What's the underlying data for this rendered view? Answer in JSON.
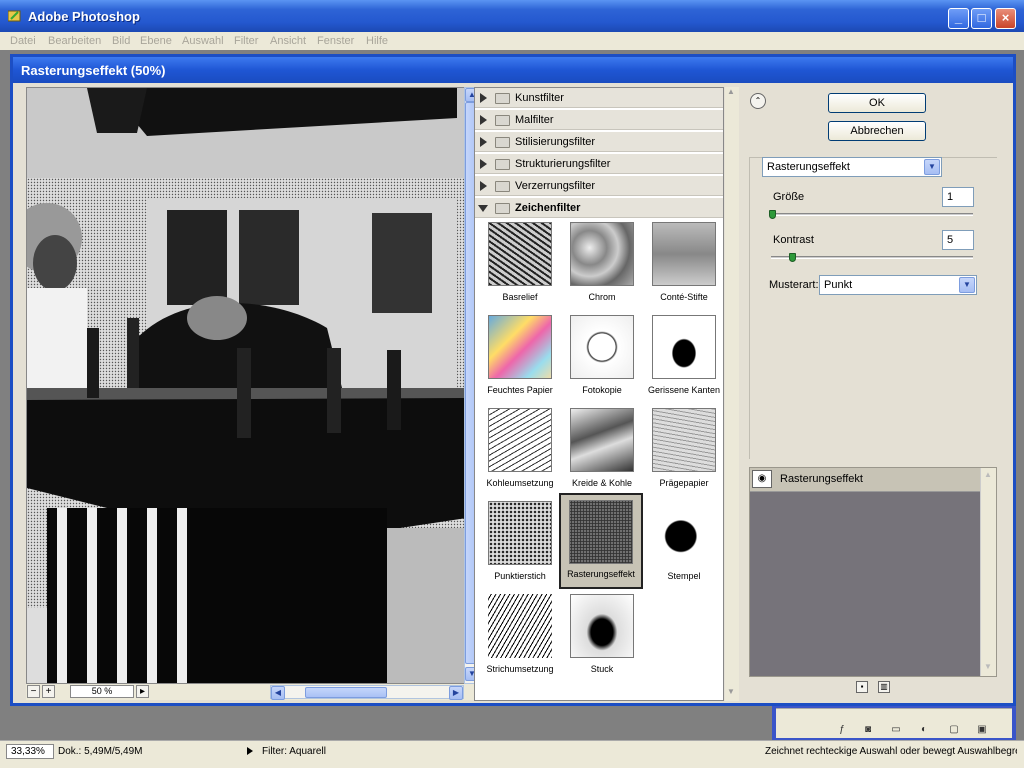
{
  "app": {
    "title": "Adobe Photoshop"
  },
  "menu": [
    "Datei",
    "Bearbeiten",
    "Bild",
    "Ebene",
    "Auswahl",
    "Filter",
    "Ansicht",
    "Fenster",
    "Hilfe"
  ],
  "dialog": {
    "title": "Rasterungseffekt (50%)",
    "zoom": "50 %",
    "categories": [
      "Kunstfilter",
      "Malfilter",
      "Stilisierungsfilter",
      "Strukturierungsfilter",
      "Verzerrungsfilter",
      "Zeichenfilter"
    ],
    "thumbnails": [
      "Basrelief",
      "Chrom",
      "Conté-Stifte",
      "Feuchtes Papier",
      "Fotokopie",
      "Gerissene Kanten",
      "Kohleumsetzung",
      "Kreide & Kohle",
      "Prägepapier",
      "Punktierstich",
      "Rasterungseffekt",
      "Stempel",
      "Strichumsetzung",
      "Stuck"
    ],
    "ok_label": "OK",
    "cancel_label": "Abbrechen",
    "filter_select": "Rasterungseffekt",
    "params": {
      "size_label": "Größe",
      "size_value": "1",
      "contrast_label": "Kontrast",
      "contrast_value": "5",
      "pattern_label": "Musterart:",
      "pattern_value": "Punkt"
    },
    "layer_name": "Rasterungseffekt"
  },
  "statusbar": {
    "zoom": "33,33%",
    "doc": "Dok.: 5,49M/5,49M",
    "filter": "Filter: Aquarell",
    "hint": "Zeichnet rechteckige Auswahl oder bewegt Auswahlbegrenzung"
  },
  "colors": {
    "title_blue": "#2458cf",
    "dialog_bg": "#e4e0d4",
    "selected_thumb": "#c7c3b5"
  }
}
